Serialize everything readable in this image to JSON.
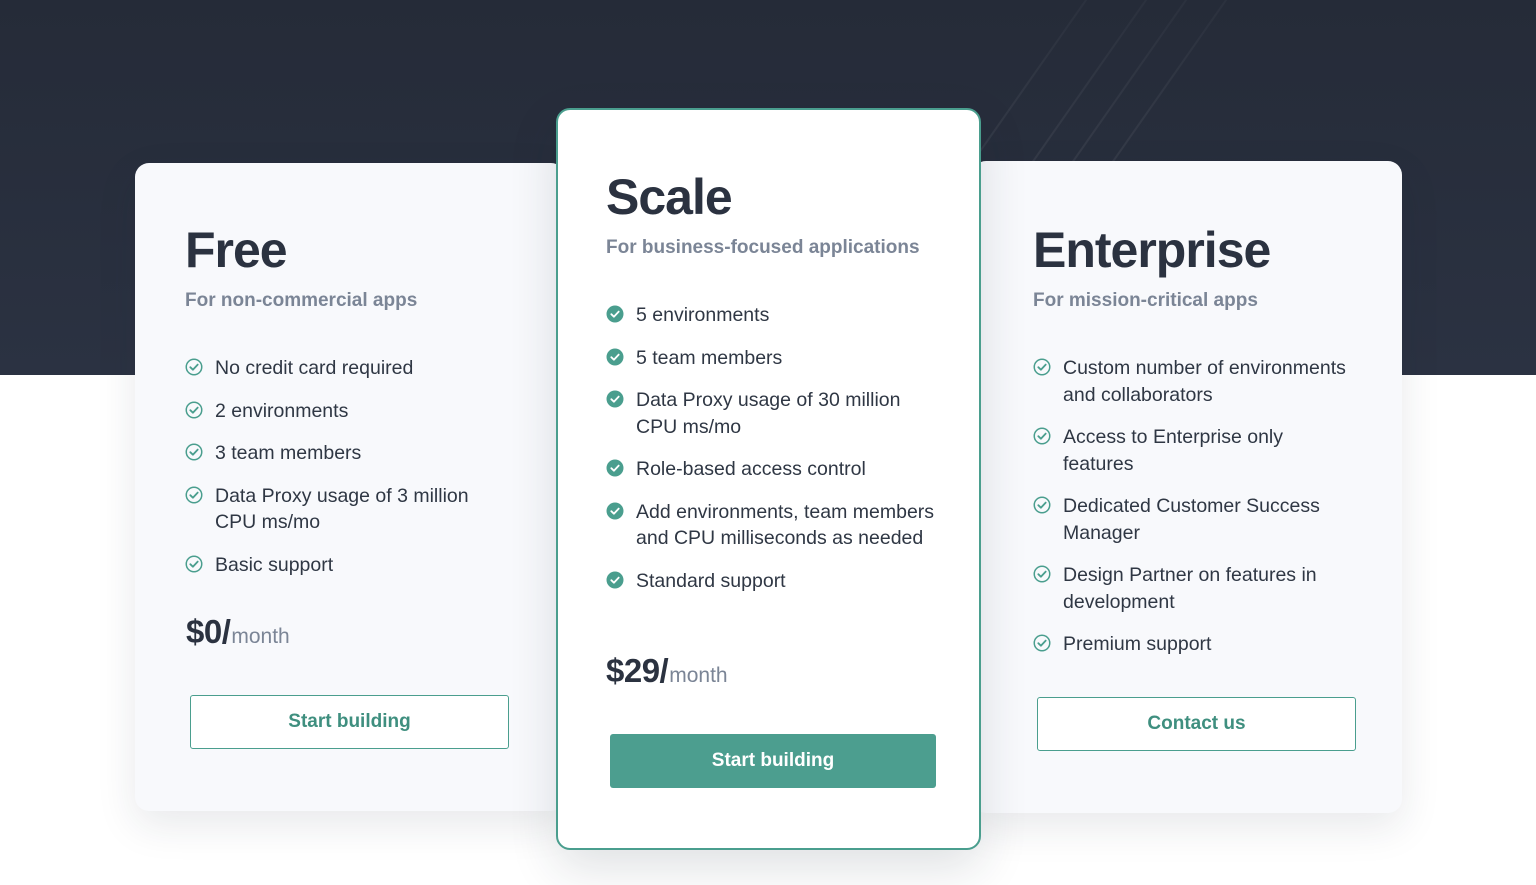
{
  "colors": {
    "accent": "#4a9e8e",
    "hero_background": "#252b38",
    "card_background": "#f8f9fc",
    "muted_text": "#7b8596"
  },
  "plans": {
    "free": {
      "name": "Free",
      "subtitle": "For non-commercial apps",
      "check_style": "outline-check-icon",
      "features": [
        "No credit card required",
        "2 environments",
        "3 team members",
        "Data Proxy usage of 3 million CPU ms/mo",
        "Basic support"
      ],
      "price": "$0/",
      "price_period": "month",
      "cta": "Start building"
    },
    "scale": {
      "name": "Scale",
      "subtitle": "For business-focused applications",
      "check_style": "filled-check-icon",
      "features": [
        "5 environments",
        "5 team members",
        "Data Proxy usage of 30 million CPU ms/mo",
        "Role-based access control",
        "Add environments, team members and CPU milliseconds as needed",
        "Standard support"
      ],
      "price": "$29/",
      "price_period": "month",
      "cta": "Start building"
    },
    "enterprise": {
      "name": "Enterprise",
      "subtitle": "For mission-critical apps",
      "check_style": "outline-check-icon",
      "features": [
        "Custom number of environments and collaborators",
        "Access to Enterprise only features",
        "Dedicated Customer Success Manager",
        "Design Partner on features in development",
        "Premium support"
      ],
      "cta": "Contact us"
    }
  }
}
